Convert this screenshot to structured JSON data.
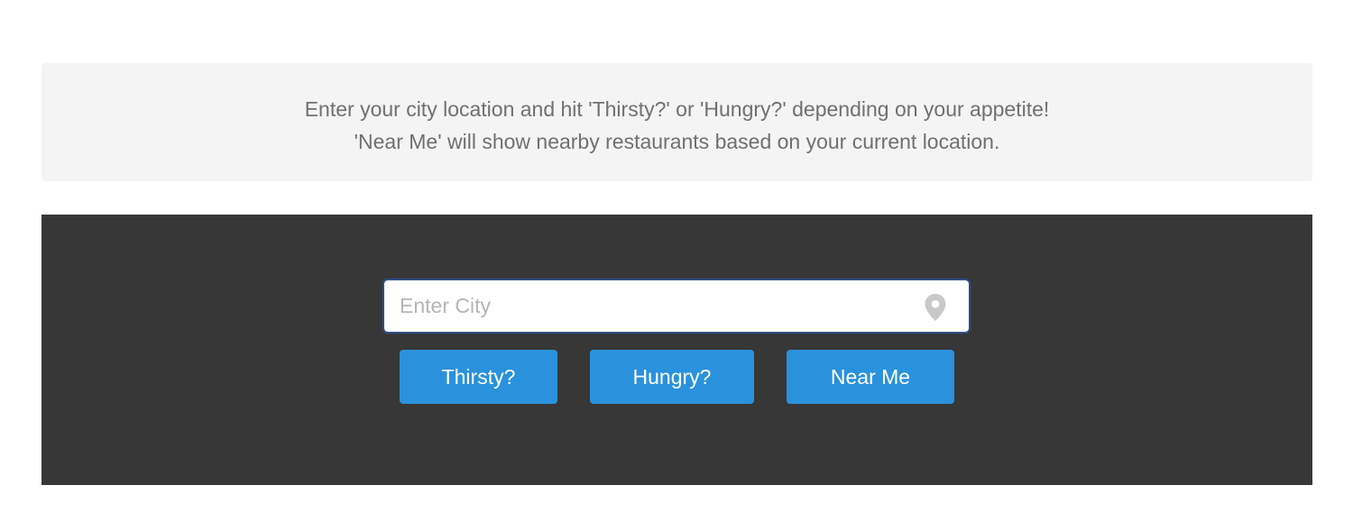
{
  "instructions": {
    "line1": "Enter your city location and hit 'Thirsty?' or 'Hungry?' depending on your appetite!",
    "line2": "'Near Me' will show nearby restaurants based on your current location."
  },
  "search": {
    "placeholder": "Enter City",
    "value": "",
    "icon": "map-pin-icon"
  },
  "buttons": {
    "thirsty_label": "Thirsty?",
    "hungry_label": "Hungry?",
    "near_me_label": "Near Me"
  },
  "colors": {
    "panel_bg": "#f4f4f4",
    "section_bg": "#373737",
    "button_bg": "#2a92dc",
    "input_border": "#2f4f86",
    "text_muted": "#707070"
  }
}
